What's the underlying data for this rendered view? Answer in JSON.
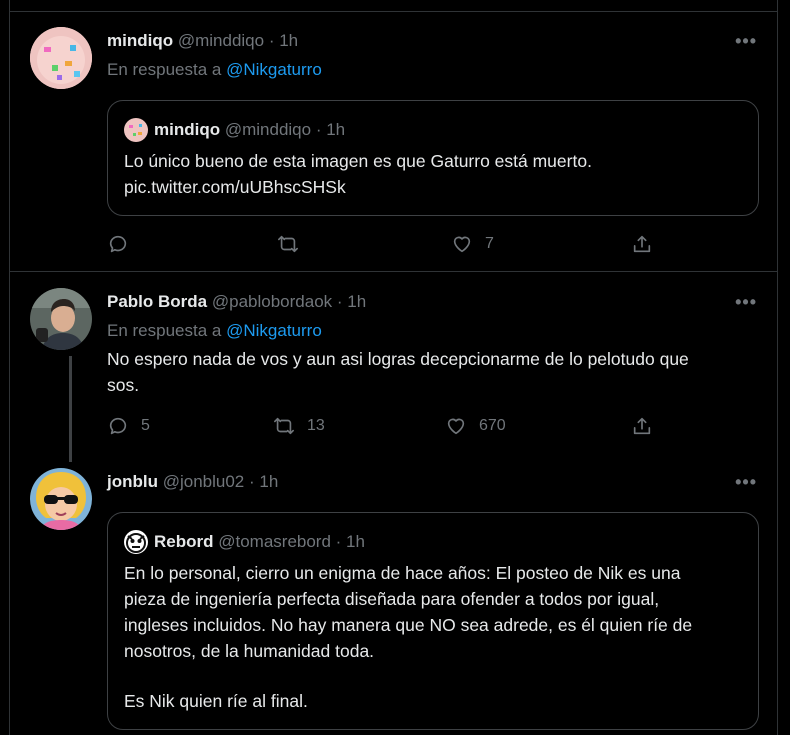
{
  "tweets": [
    {
      "name": "mindiqo",
      "handle": "@minddiqo",
      "time": "· 1h",
      "reply_prefix": "En respuesta a",
      "reply_to": "@Nikgaturro",
      "quote": {
        "name": "mindiqo",
        "handle": "@minddiqo",
        "time": "· 1h",
        "text_line1": "Lo único bueno de esta imagen es que Gaturro está muerto.",
        "text_line2": "pic.twitter.com/uUBhscSHSk"
      },
      "actions": {
        "reply": "",
        "retweet": "",
        "like": "7"
      }
    },
    {
      "name": "Pablo Borda",
      "handle": "@pablobordaok",
      "time": "· 1h",
      "reply_prefix": "En respuesta a",
      "reply_to": "@Nikgaturro",
      "text_line1": "No espero nada de vos y aun asi logras decepcionarme de lo pelotudo que",
      "text_line2": "sos.",
      "actions": {
        "reply": "5",
        "retweet": "13",
        "like": "670"
      }
    },
    {
      "name": "jonblu",
      "handle": "@jonblu02",
      "time": "· 1h",
      "quote": {
        "name": "Rebord",
        "handle": "@tomasrebord",
        "time": "· 1h",
        "lines": [
          "En lo personal, cierro un enigma de hace años: El posteo de Nik es una",
          "pieza de ingeniería perfecta diseñada para ofender a todos por igual,",
          "ingleses incluidos. No hay manera que NO sea adrede, es él quien ríe de",
          "nosotros, de la humanidad toda.",
          "Es Nik quien ríe al final."
        ]
      }
    }
  ],
  "more_label": "•••",
  "colors": {
    "background": "#000000",
    "text": "#e7e9ea",
    "muted": "#71767b",
    "link": "#1d9bf0",
    "border": "#2f3336"
  }
}
